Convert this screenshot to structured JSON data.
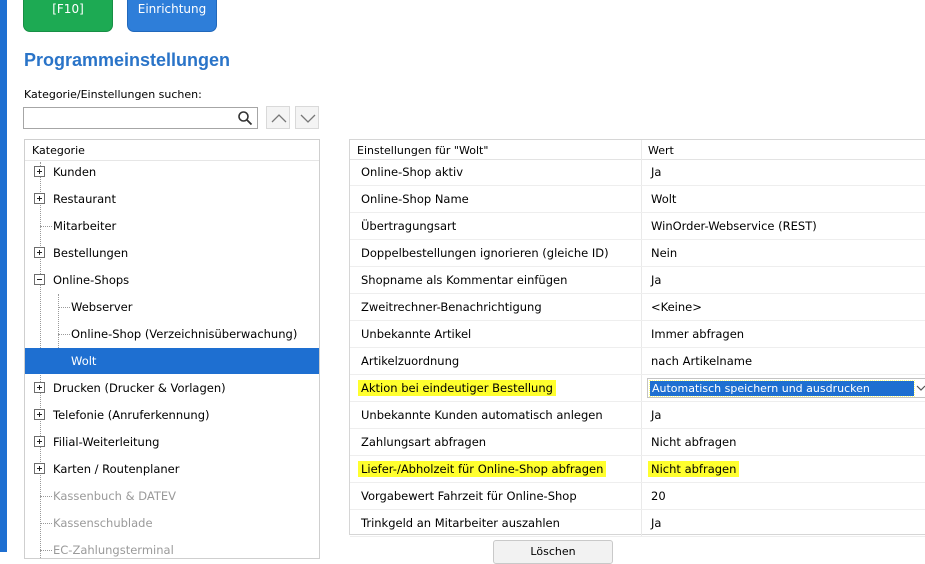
{
  "top_buttons": {
    "f10_label": "[F10]",
    "setup_label": "Einrichtung"
  },
  "page_title": "Programmeinstellungen",
  "search": {
    "label": "Kategorie/Einstellungen suchen:",
    "value": "",
    "placeholder": ""
  },
  "tree": {
    "header": "Kategorie",
    "items": [
      {
        "label": "Kunden"
      },
      {
        "label": "Restaurant"
      },
      {
        "label": "Mitarbeiter"
      },
      {
        "label": "Bestellungen"
      },
      {
        "label": "Online-Shops"
      },
      {
        "label": "Webserver"
      },
      {
        "label": "Online-Shop (Verzeichnisüberwachung)"
      },
      {
        "label": "Wolt"
      },
      {
        "label": "Drucken (Drucker & Vorlagen)"
      },
      {
        "label": "Telefonie (Anruferkennung)"
      },
      {
        "label": "Filial-Weiterleitung"
      },
      {
        "label": "Karten / Routenplaner"
      },
      {
        "label": "Kassenbuch & DATEV"
      },
      {
        "label": "Kassenschublade"
      },
      {
        "label": "EC-Zahlungsterminal"
      }
    ]
  },
  "grid": {
    "col_setting": "Einstellungen für \"Wolt\"",
    "col_value": "Wert",
    "rows": [
      {
        "name": "Online-Shop aktiv",
        "value": "Ja"
      },
      {
        "name": "Online-Shop Name",
        "value": "Wolt"
      },
      {
        "name": "Übertragungsart",
        "value": "WinOrder-Webservice (REST)"
      },
      {
        "name": "Doppelbestellungen ignorieren (gleiche ID)",
        "value": "Nein"
      },
      {
        "name": "Shopname als Kommentar einfügen",
        "value": "Ja"
      },
      {
        "name": "Zweitrechner-Benachrichtigung",
        "value": "<Keine>"
      },
      {
        "name": "Unbekannte Artikel",
        "value": "Immer abfragen"
      },
      {
        "name": "Artikelzuordnung",
        "value": "nach Artikelname"
      },
      {
        "name": "Aktion bei eindeutiger Bestellung",
        "value": "Automatisch speichern und ausdrucken"
      },
      {
        "name": "Unbekannte Kunden automatisch anlegen",
        "value": "Ja"
      },
      {
        "name": "Zahlungsart abfragen",
        "value": "Nicht abfragen"
      },
      {
        "name": "Liefer-/Abholzeit für Online-Shop abfragen",
        "value": "Nicht abfragen"
      },
      {
        "name": "Vorgabewert Fahrzeit für Online-Shop",
        "value": "20"
      },
      {
        "name": "Trinkgeld an Mitarbeiter auszahlen",
        "value": "Ja"
      }
    ]
  },
  "delete_button": "Löschen",
  "colors": {
    "accent": "#1e6fd1",
    "title": "#2a74c8",
    "green_button": "#1daa53",
    "highlight": "#ffff2e"
  }
}
